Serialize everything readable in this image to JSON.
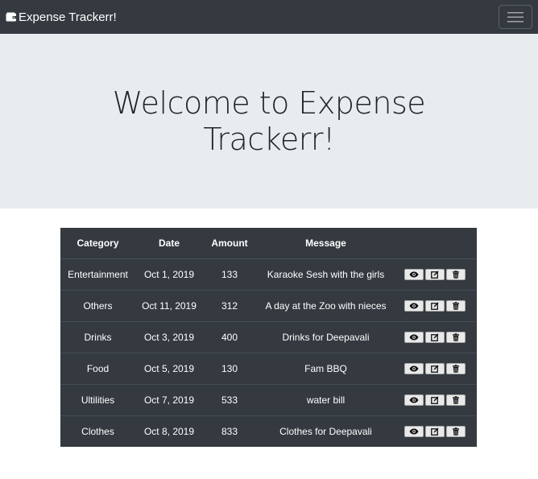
{
  "navbar": {
    "brand_label": "Expense Trackerr!",
    "brand_icon": "wallet-icon",
    "toggler_icon": "hamburger-icon"
  },
  "jumbotron": {
    "title": "Welcome to Expense Trackerr!"
  },
  "table": {
    "headers": {
      "category": "Category",
      "date": "Date",
      "amount": "Amount",
      "message": "Message",
      "actions": ""
    },
    "rows": [
      {
        "category": "Entertainment",
        "date": "Oct 1, 2019",
        "amount": "133",
        "message": "Karaoke Sesh with the girls"
      },
      {
        "category": "Others",
        "date": "Oct 11, 2019",
        "amount": "312",
        "message": "A day at the Zoo with nieces"
      },
      {
        "category": "Drinks",
        "date": "Oct 3, 2019",
        "amount": "400",
        "message": "Drinks for Deepavali"
      },
      {
        "category": "Food",
        "date": "Oct 5, 2019",
        "amount": "130",
        "message": "Fam BBQ"
      },
      {
        "category": "Ultilities",
        "date": "Oct 7, 2019",
        "amount": "533",
        "message": "water bill"
      },
      {
        "category": "Clothes",
        "date": "Oct 8, 2019",
        "amount": "833",
        "message": "Clothes for Deepavali"
      }
    ],
    "row_action_icons": [
      "eye-icon",
      "edit-icon",
      "trash-icon"
    ]
  },
  "colors": {
    "navbar_bg": "#343a40",
    "jumbotron_bg": "#e9ecef",
    "table_bg": "#343a40",
    "row_border": "#454d55",
    "button_bg": "#e9e9e9"
  }
}
